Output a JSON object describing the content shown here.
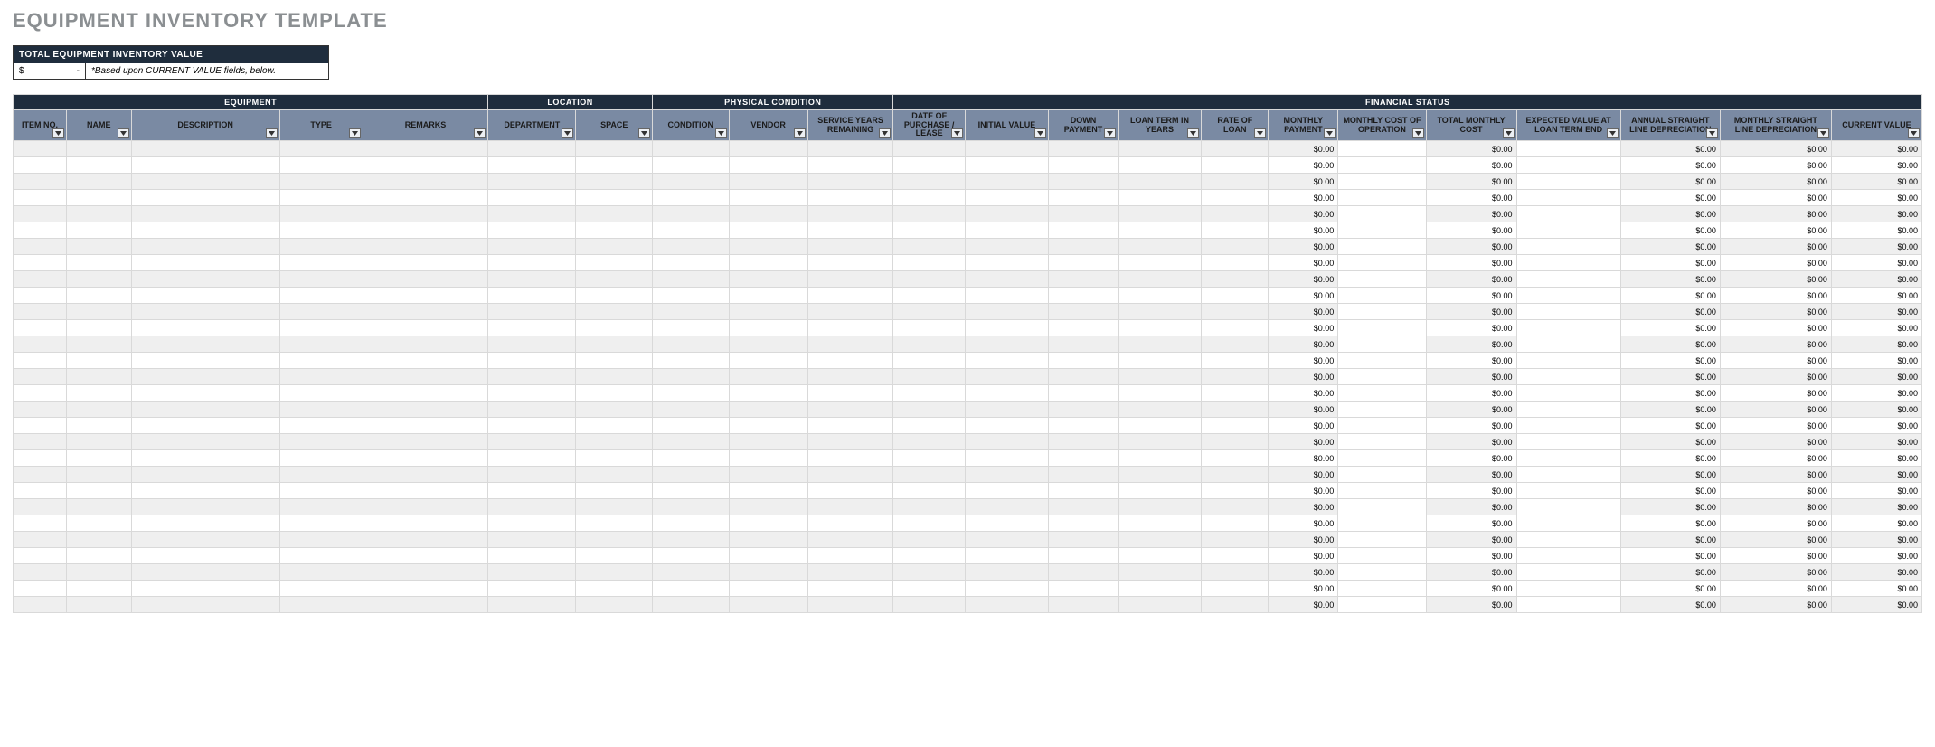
{
  "title": "EQUIPMENT INVENTORY TEMPLATE",
  "summary": {
    "header": "TOTAL EQUIPMENT INVENTORY VALUE",
    "currency": "$",
    "value": "-",
    "note": "*Based upon CURRENT VALUE fields, below."
  },
  "groups": [
    {
      "label": "EQUIPMENT",
      "span": 5
    },
    {
      "label": "LOCATION",
      "span": 2
    },
    {
      "label": "PHYSICAL CONDITION",
      "span": 3
    },
    {
      "label": "FINANCIAL STATUS",
      "span": 12
    }
  ],
  "columns": [
    "ITEM NO.",
    "NAME",
    "DESCRIPTION",
    "TYPE",
    "REMARKS",
    "DEPARTMENT",
    "SPACE",
    "CONDITION",
    "VENDOR",
    "SERVICE YEARS REMAINING",
    "DATE OF PURCHASE / LEASE",
    "INITIAL VALUE",
    "DOWN PAYMENT",
    "LOAN TERM IN YEARS",
    "RATE OF LOAN",
    "MONTHLY PAYMENT",
    "MONTHLY COST OF OPERATION",
    "TOTAL MONTHLY COST",
    "EXPECTED VALUE AT LOAN TERM END",
    "ANNUAL STRAIGHT LINE DEPRECIATION",
    "MONTHLY STRAIGHT LINE DEPRECIATION",
    "CURRENT VALUE"
  ],
  "calc_cols": [
    15,
    17,
    19,
    20,
    21
  ],
  "dollar_default": "$0.00",
  "row_count": 29
}
